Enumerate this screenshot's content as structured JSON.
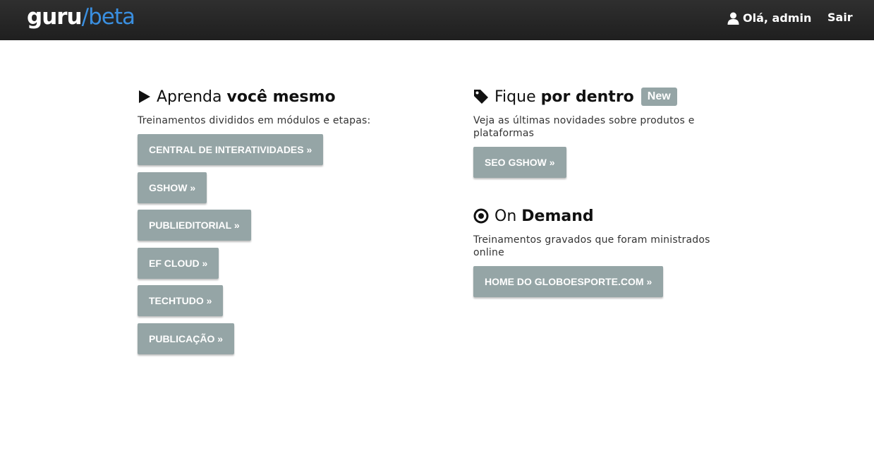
{
  "header": {
    "logo_guru": "guru",
    "logo_slash": "/",
    "logo_beta": "beta",
    "greeting": "Olá, admin",
    "logout": "Sair",
    "user_icon": "user-icon"
  },
  "learn": {
    "icon": "play-icon",
    "title_light": "Aprenda",
    "title_bold": "você mesmo",
    "description": "Treinamentos divididos em módulos e etapas:",
    "buttons": [
      "CENTRAL DE INTERATIVIDADES »",
      "GSHOW »",
      "PUBLIEDITORIAL »",
      "EF CLOUD »",
      "TECHTUDO »",
      "PUBLICAÇÃO »"
    ]
  },
  "news": {
    "icon": "tag-icon",
    "title_light": "Fique",
    "title_bold": "por dentro",
    "badge": "New",
    "description_line1": "Veja as últimas novidades sobre produtos e",
    "description_line2": "plataformas",
    "buttons": [
      "SEO GSHOW »"
    ]
  },
  "ondemand": {
    "icon": "target-icon",
    "title_light": "On",
    "title_bold": "Demand",
    "description_line1": "Treinamentos gravados que foram ministrados",
    "description_line2": "online",
    "buttons": [
      "HOME DO GLOBOESPORTE.COM »"
    ]
  },
  "colors": {
    "topbar": "#262626",
    "accent": "#3a8fe0",
    "button": "#95a5a6"
  }
}
